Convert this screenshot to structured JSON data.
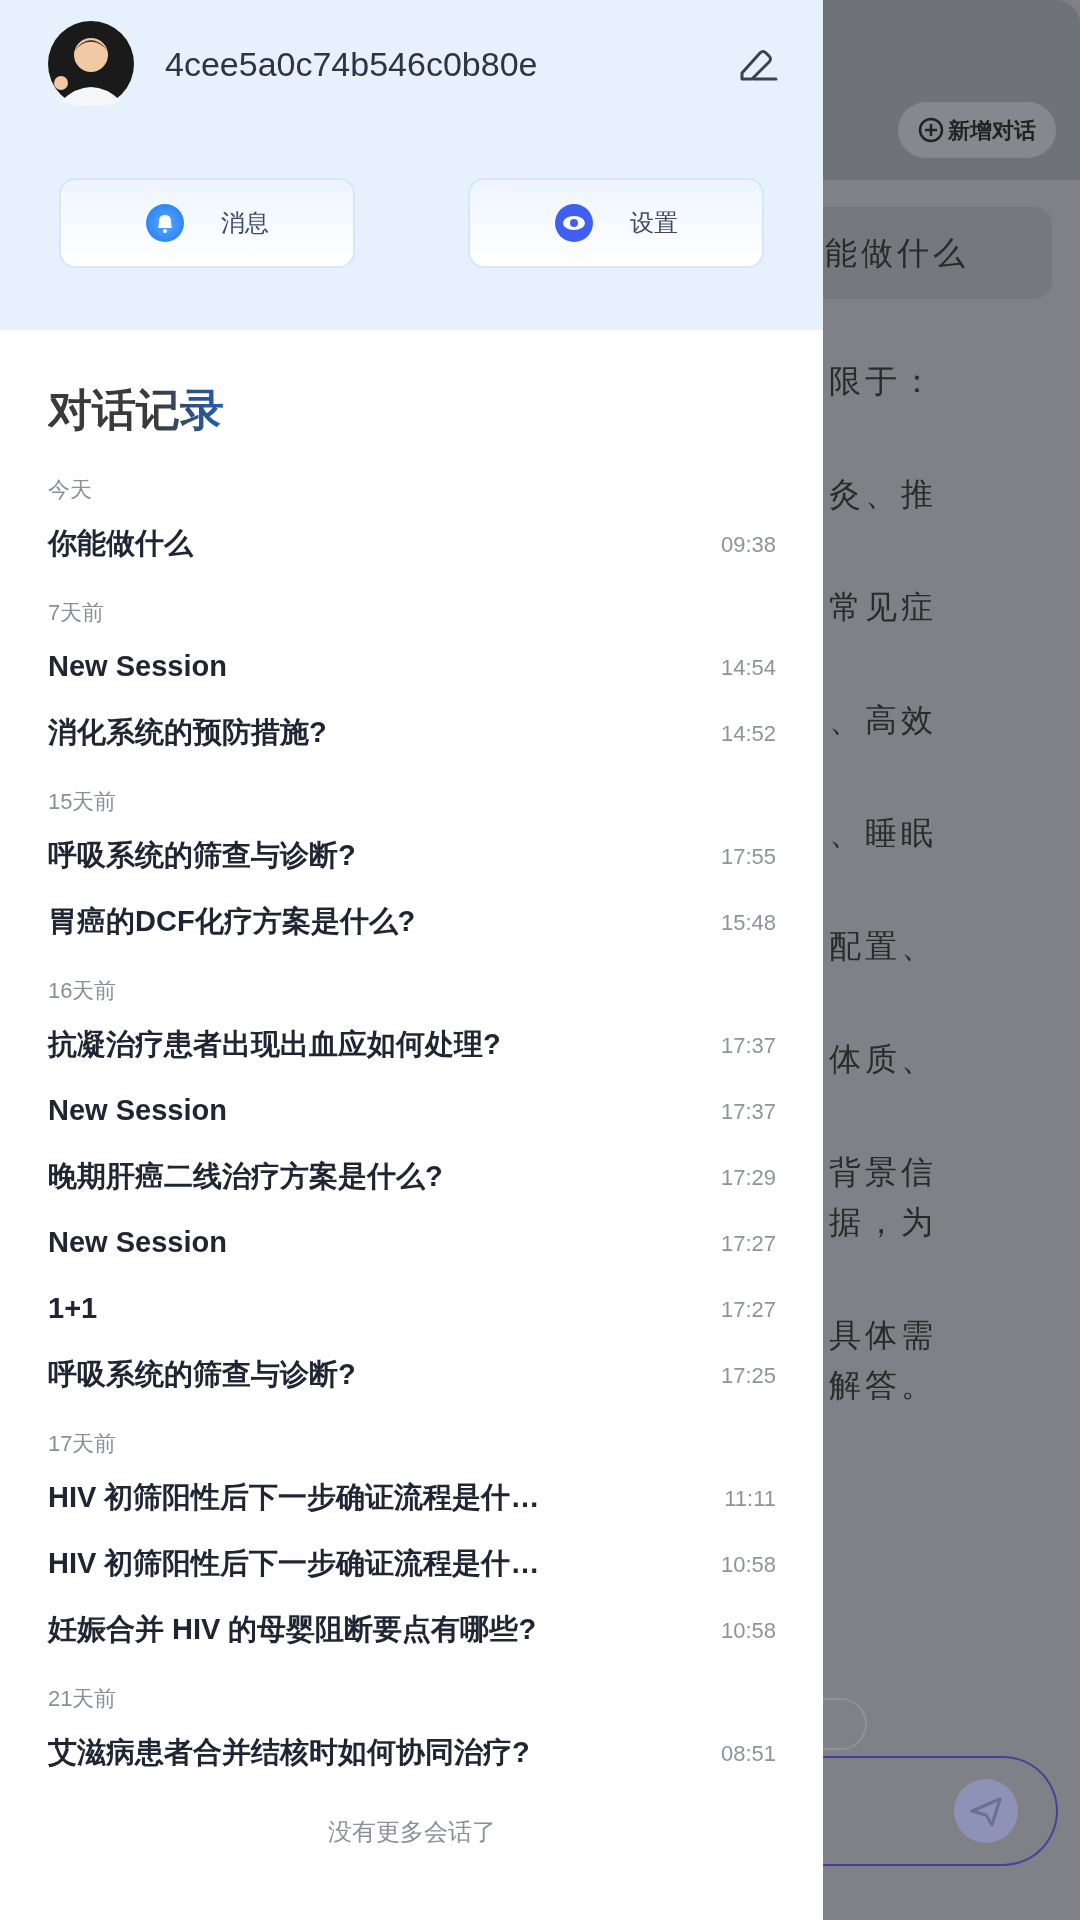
{
  "drawer": {
    "profile": {
      "username": "4cee5a0c74b546c0b80e"
    },
    "actions": [
      {
        "label": "消息",
        "kind": "bell"
      },
      {
        "label": "设置",
        "kind": "eye"
      }
    ],
    "history": {
      "title": "对话记录",
      "groups": [
        {
          "label": "今天",
          "sessions": [
            {
              "title": "你能做什么",
              "time": "09:38"
            }
          ]
        },
        {
          "label": "7天前",
          "sessions": [
            {
              "title": "New Session",
              "time": "14:54"
            },
            {
              "title": "消化系统的预防措施?",
              "time": "14:52"
            }
          ]
        },
        {
          "label": "15天前",
          "sessions": [
            {
              "title": "呼吸系统的筛查与诊断?",
              "time": "17:55"
            },
            {
              "title": "胃癌的DCF化疗方案是什么?",
              "time": "15:48"
            }
          ]
        },
        {
          "label": "16天前",
          "sessions": [
            {
              "title": "抗凝治疗患者出现出血应如何处理?",
              "time": "17:37"
            },
            {
              "title": "New Session",
              "time": "17:37"
            },
            {
              "title": "晚期肝癌二线治疗方案是什么?",
              "time": "17:29"
            },
            {
              "title": "New Session",
              "time": "17:27"
            },
            {
              "title": "1+1",
              "time": "17:27"
            },
            {
              "title": "呼吸系统的筛查与诊断?",
              "time": "17:25"
            }
          ]
        },
        {
          "label": "17天前",
          "sessions": [
            {
              "title": "HIV 初筛阳性后下一步确证流程是什…",
              "time": "11:11"
            },
            {
              "title": "HIV 初筛阳性后下一步确证流程是什…",
              "time": "10:58"
            },
            {
              "title": "妊娠合并 HIV 的母婴阻断要点有哪些?",
              "time": "10:58"
            }
          ]
        },
        {
          "label": "21天前",
          "sessions": [
            {
              "title": "艾滋病患者合并结核时如何协同治疗?",
              "time": "08:51"
            }
          ]
        }
      ],
      "end_note": "没有更多会话了"
    }
  },
  "background": {
    "new_chat_button": "新增对话",
    "user_message": "能做什么",
    "reply_paragraphs": [
      [
        "限于："
      ],
      [
        "灸、推"
      ],
      [
        "常见症"
      ],
      [
        "、高效"
      ],
      [
        "、睡眠"
      ],
      [
        "配置、"
      ],
      [
        "体质、"
      ],
      [
        "背景信",
        "据，为"
      ],
      [
        "具体需",
        "解答。"
      ]
    ]
  }
}
